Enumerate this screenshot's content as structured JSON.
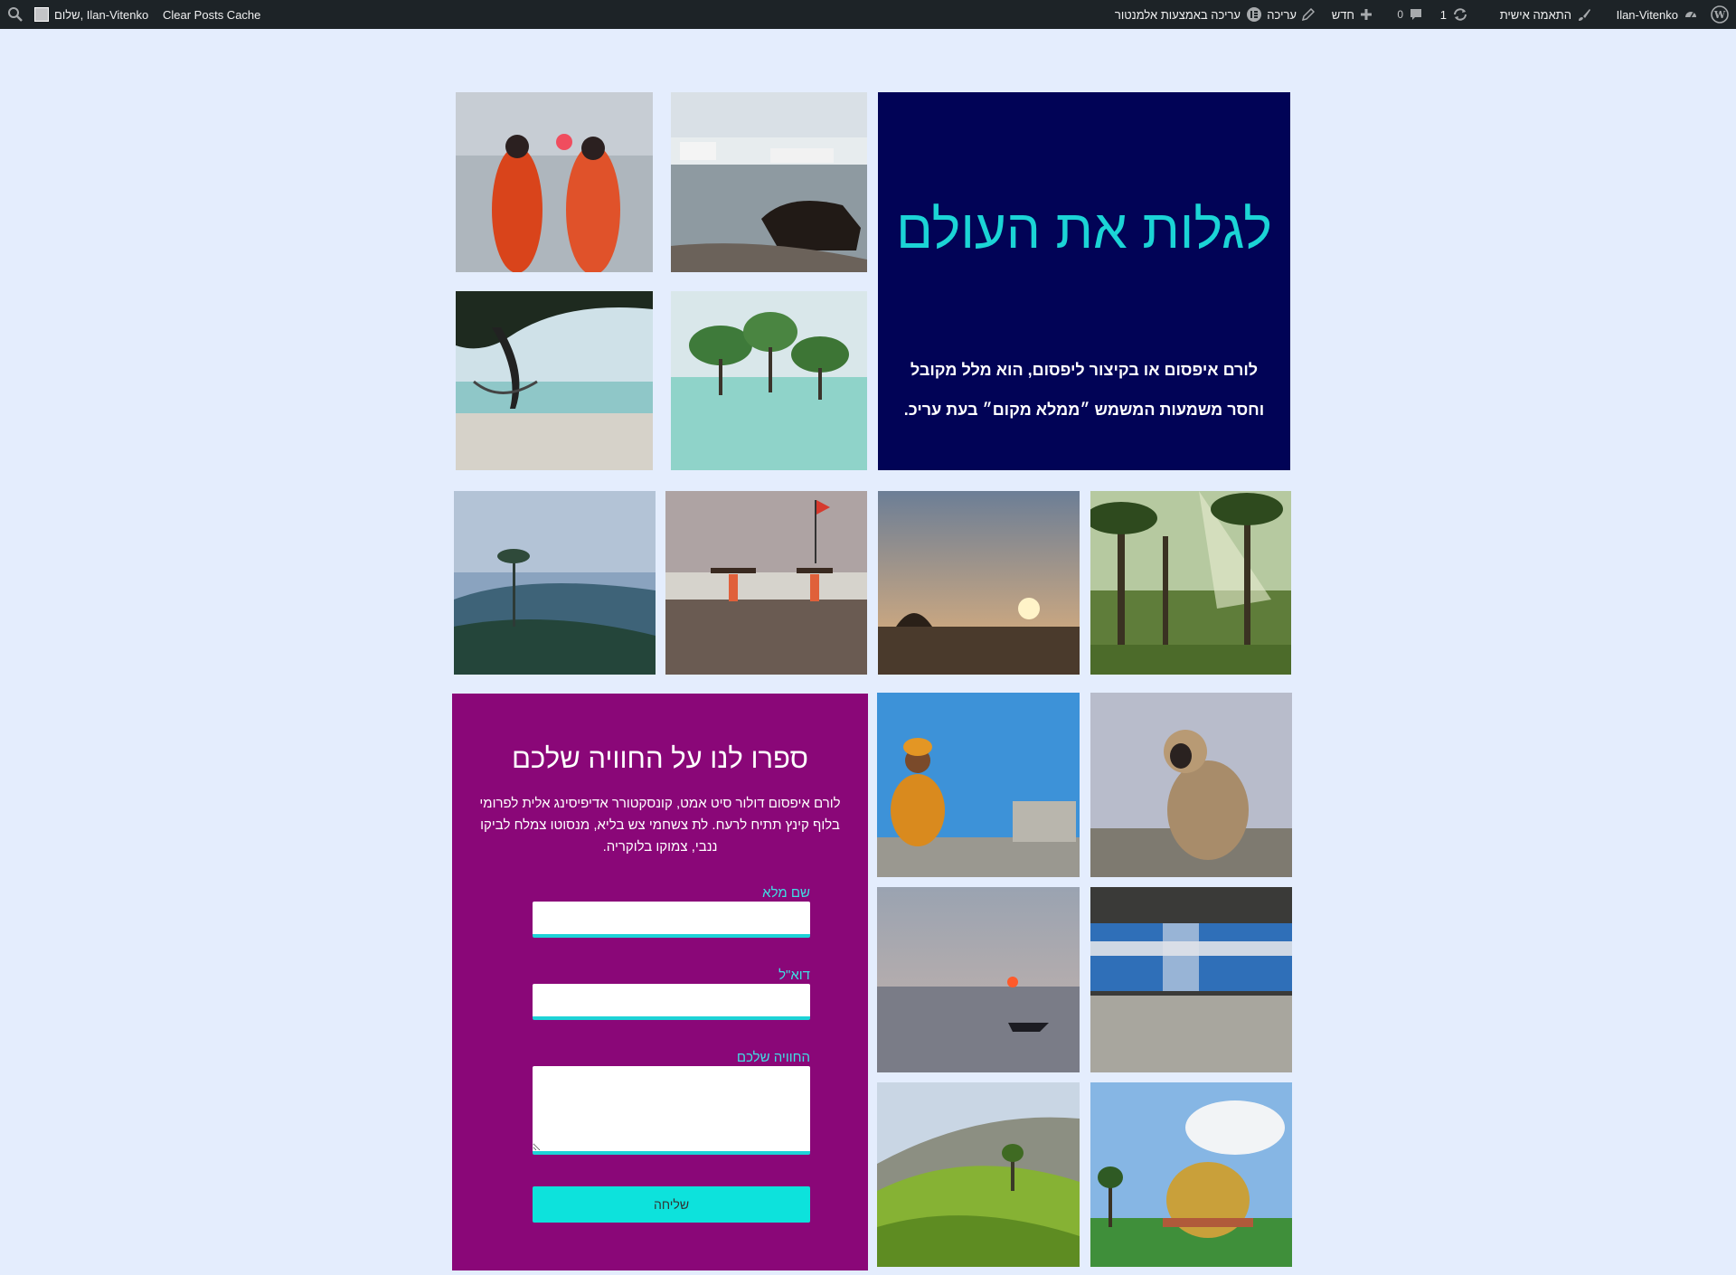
{
  "admin_bar": {
    "right_items": {
      "wp_logo_icon": "wordpress-icon",
      "site_name": "Ilan-Vitenko",
      "customize": "התאמה אישית",
      "updates_count": "1",
      "comments_count": "0",
      "new": "חדש",
      "edit": "עריכה",
      "edit_elementor": "עריכה באמצעות אלמנטור"
    },
    "left_items": {
      "greeting": "שלום, Ilan-Vitenko",
      "clear_cache": "Clear Posts Cache"
    }
  },
  "hero": {
    "title": "לגלות את העולם",
    "text": "לורם איפסום או בקיצור ליפסום, הוא מלל מקובל וחסר משמעות המשמש ״ממלא מקום״ בעת עריכ."
  },
  "form": {
    "title": "ספרו לנו על החוויה שלכם",
    "intro": "לורם איפסום דולור סיט אמט, קונסקטורר אדיפיסינג אלית לפרומי בלוף קינץ תתיח לרעח. לת צשחמי צש בליא, מנסוטו צמלח לביקו ננבי, צמוקו בלוקריה.",
    "name_label": "שם מלא",
    "email_label": "דוא\"ל",
    "experience_label": "החוויה שלכם",
    "name_value": "",
    "email_value": "",
    "experience_value": "",
    "submit_label": "שליחה"
  },
  "colors": {
    "page_bg": "#e4edfd",
    "admin_bar": "#1d2327",
    "hero_bg": "#010356",
    "hero_title": "#1bd4d6",
    "form_bg": "#8a0778",
    "accent": "#0de2dc"
  },
  "photos": [
    "women-at-sunrise-photo",
    "cow-by-lake-photo",
    "beach-hammock-photo",
    "mangrove-trees-photo",
    "misty-hills-photo",
    "beach-wood-carriers-photo",
    "sunset-shore-photo",
    "palm-forest-photo",
    "sadhu-blue-wall-photo",
    "langur-monkey-photo",
    "river-sunset-boat-photo",
    "blue-train-photo",
    "tea-plantation-photo",
    "golden-dome-photo"
  ]
}
